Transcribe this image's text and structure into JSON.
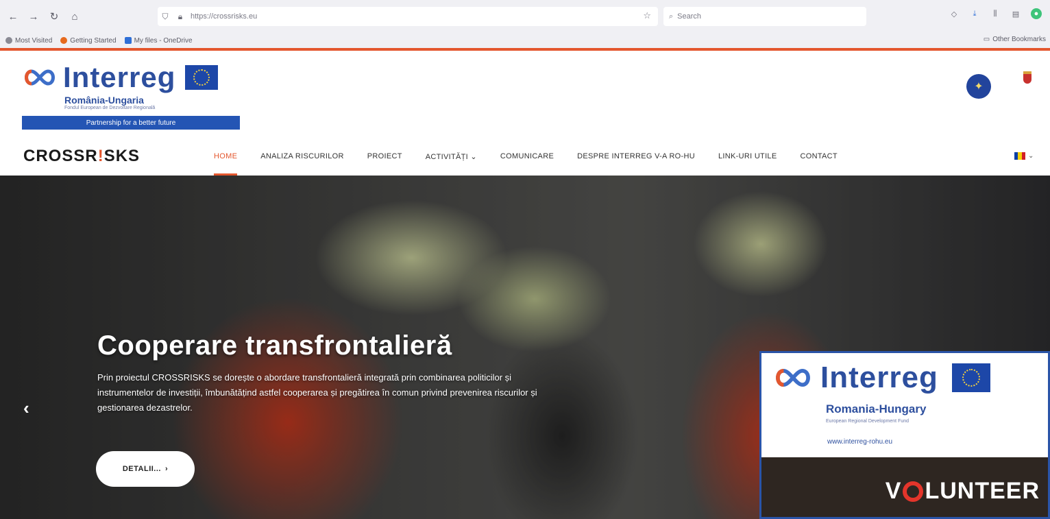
{
  "browser": {
    "url": "https://crossrisks.eu",
    "search_placeholder": "Search",
    "bookmarks": [
      "Most Visited",
      "Getting Started",
      "My files - OneDrive"
    ],
    "other_bookmarks": "Other Bookmarks"
  },
  "header": {
    "logo": {
      "word": "Interreg",
      "subtitle": "România-Ungaria",
      "tagline": "Fondul European de Dezvoltare Regională",
      "band": "Partnership for a better future"
    },
    "brand_left": "CROSSR",
    "brand_bang": "!",
    "brand_right": "SKS",
    "nav": [
      {
        "label": "HOME",
        "active": true
      },
      {
        "label": "ANALIZA RISCURILOR",
        "active": false
      },
      {
        "label": "PROIECT",
        "active": false
      },
      {
        "label": "ACTIVITĂȚI ⌄",
        "active": false
      },
      {
        "label": "COMUNICARE",
        "active": false
      },
      {
        "label": "DESPRE INTERREG V-A RO-HU",
        "active": false
      },
      {
        "label": "LINK-URI UTILE",
        "active": false
      },
      {
        "label": "CONTACT",
        "active": false
      }
    ],
    "lang_caret": "⌄"
  },
  "hero": {
    "title": "Cooperare transfrontalieră",
    "text": "Prin proiectul CROSSRISKS se dorește o abordare transfrontalieră integrată prin combinarea politicilor și instrumentelor de investiții, îmbunătățind astfel cooperarea și pregătirea în comun privind prevenirea riscurilor și gestionarea dezastrelor.",
    "button": "DETALII...",
    "button_icon": "›",
    "prev_icon": "‹"
  },
  "side_banner": {
    "word": "Interreg",
    "subtitle": "Romania-Hungary",
    "tagline": "European Regional Development Fund",
    "url": "www.interreg-rohu.eu",
    "volunteer_v": "V",
    "volunteer_rest": "LUNTEER"
  },
  "colors": {
    "accent": "#e4572e",
    "interreg_blue": "#2d4f9e",
    "eu_blue": "#1d47a8"
  }
}
